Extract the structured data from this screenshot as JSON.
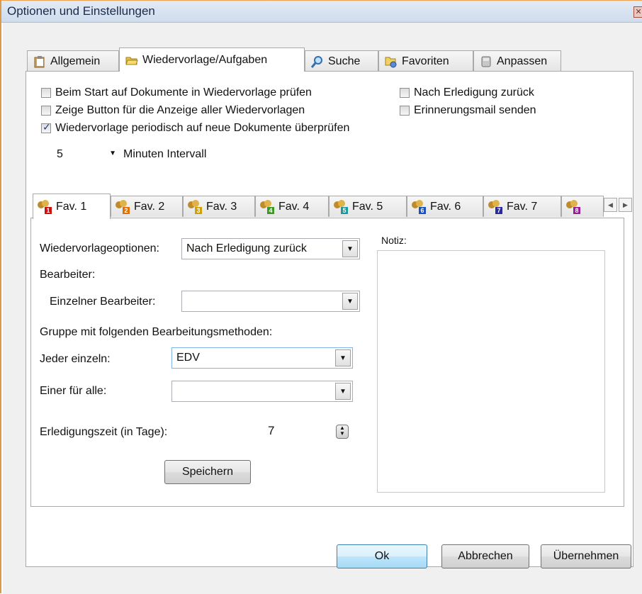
{
  "window": {
    "title": "Optionen und Einstellungen",
    "close_glyph": "✕"
  },
  "tabs": [
    {
      "label": "Allgemein",
      "icon": "clipboard-icon"
    },
    {
      "label": "Wiedervorlage/Aufgaben",
      "icon": "folder-open-icon",
      "active": true
    },
    {
      "label": "Suche",
      "icon": "magnifier-icon"
    },
    {
      "label": "Favoriten",
      "icon": "favorites-folder-icon"
    },
    {
      "label": "Anpassen",
      "icon": "customize-icon"
    }
  ],
  "options": {
    "check_start": {
      "label": "Beim Start auf Dokumente in Wiedervorlage prüfen",
      "checked": false
    },
    "show_button": {
      "label": "Zeige Button für die Anzeige aller Wiedervorlagen",
      "checked": false
    },
    "periodic_check": {
      "label": "Wiedervorlage periodisch auf neue Dokumente überprüfen",
      "checked": true
    },
    "after_done_back": {
      "label": "Nach Erledigung zurück",
      "checked": false
    },
    "reminder_mail": {
      "label": "Erinnerungsmail senden",
      "checked": false
    },
    "interval_value": "5",
    "interval_label": "Minuten Intervall"
  },
  "fav_tabs": [
    {
      "label": "Fav. 1",
      "num": "1",
      "color": "#d01010",
      "active": true
    },
    {
      "label": "Fav. 2",
      "num": "2",
      "color": "#e07000"
    },
    {
      "label": "Fav. 3",
      "num": "3",
      "color": "#d0a000"
    },
    {
      "label": "Fav. 4",
      "num": "4",
      "color": "#3a9a20"
    },
    {
      "label": "Fav. 5",
      "num": "5",
      "color": "#1a9a9a"
    },
    {
      "label": "Fav. 6",
      "num": "6",
      "color": "#1a50c0"
    },
    {
      "label": "Fav. 7",
      "num": "7",
      "color": "#2a2a9a"
    },
    {
      "label": "",
      "num": "8",
      "color": "#9a1a9a"
    }
  ],
  "fav_form": {
    "options_label": "Wiedervorlageoptionen:",
    "options_value": "Nach Erledigung zurück",
    "editor_label": "Bearbeiter:",
    "single_editor_label": "Einzelner Bearbeiter:",
    "single_editor_value": "",
    "group_label": "Gruppe mit folgenden Bearbeitungsmethoden:",
    "each_label": "Jeder einzeln:",
    "each_value": "EDV",
    "one_for_all_label": "Einer für alle:",
    "one_for_all_value": "",
    "time_label": "Erledigungszeit (in Tage):",
    "time_value": "7",
    "save_label": "Speichern",
    "note_label": "Notiz:"
  },
  "footer": {
    "ok": "Ok",
    "cancel": "Abbrechen",
    "apply": "Übernehmen"
  },
  "colors": {
    "titlebar": "#d6e2f0",
    "accent_border": "#d99a4a",
    "default_button": "#bee6fd"
  }
}
